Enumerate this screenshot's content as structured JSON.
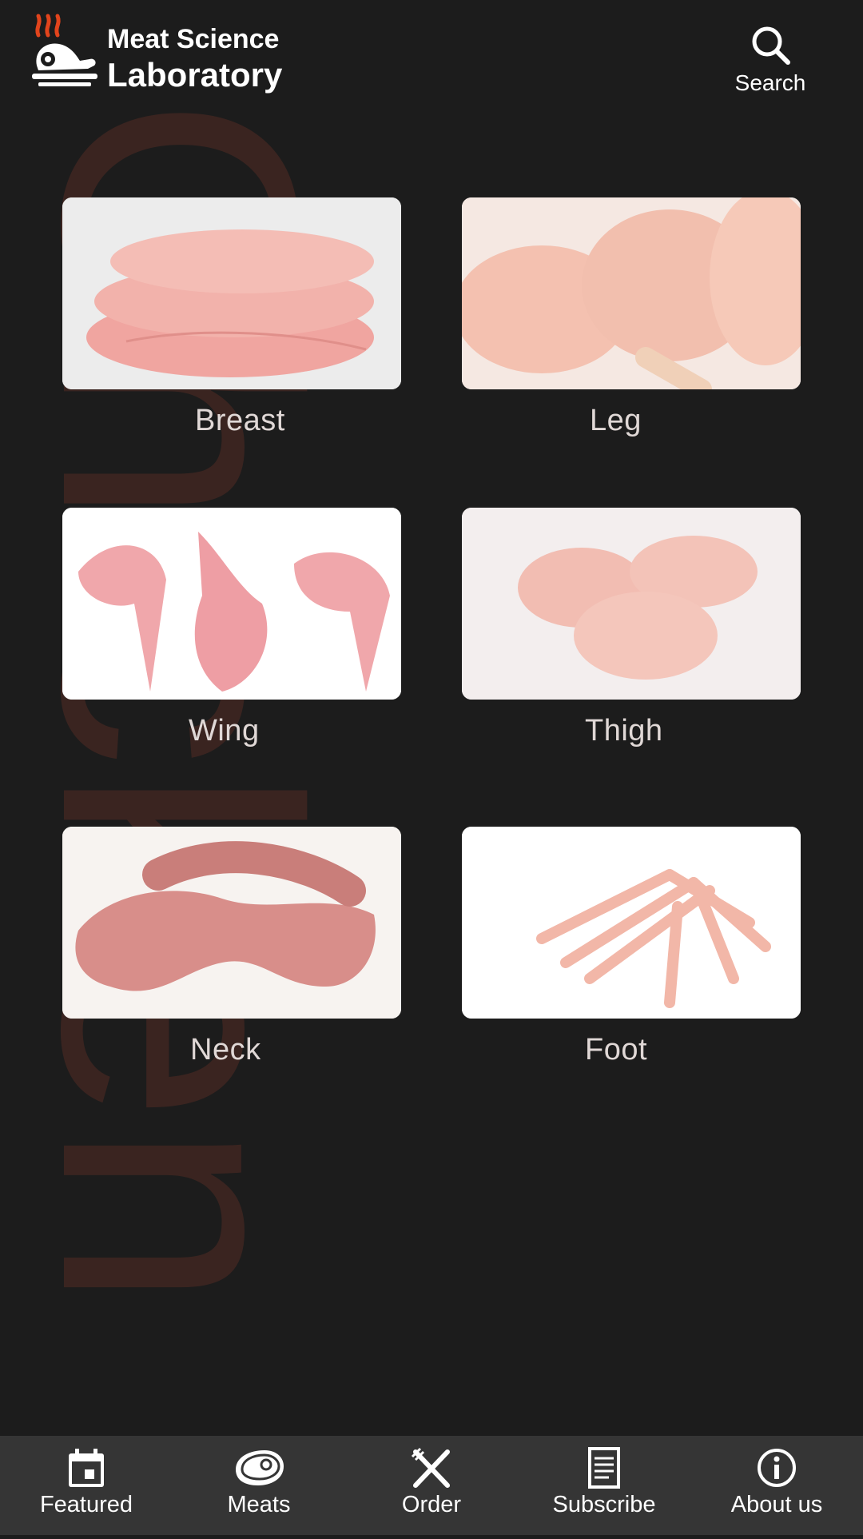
{
  "header": {
    "brand_line1": "Meat Science",
    "brand_line2": "Laboratory",
    "search_label": "Search"
  },
  "colors": {
    "background": "#1c1c1c",
    "watermark": "#3a2420",
    "nav_background": "#353535",
    "flame": "#e2441c"
  },
  "watermark_text": "Chicken",
  "cuts": [
    {
      "label": "Breast"
    },
    {
      "label": "Leg"
    },
    {
      "label": "Wing"
    },
    {
      "label": "Thigh"
    },
    {
      "label": "Neck"
    },
    {
      "label": "Foot"
    }
  ],
  "nav": [
    {
      "label": "Featured",
      "icon": "calendar-icon"
    },
    {
      "label": "Meats",
      "icon": "steak-icon"
    },
    {
      "label": "Order",
      "icon": "fork-knife-icon"
    },
    {
      "label": "Subscribe",
      "icon": "document-icon"
    },
    {
      "label": "About us",
      "icon": "info-icon"
    }
  ]
}
